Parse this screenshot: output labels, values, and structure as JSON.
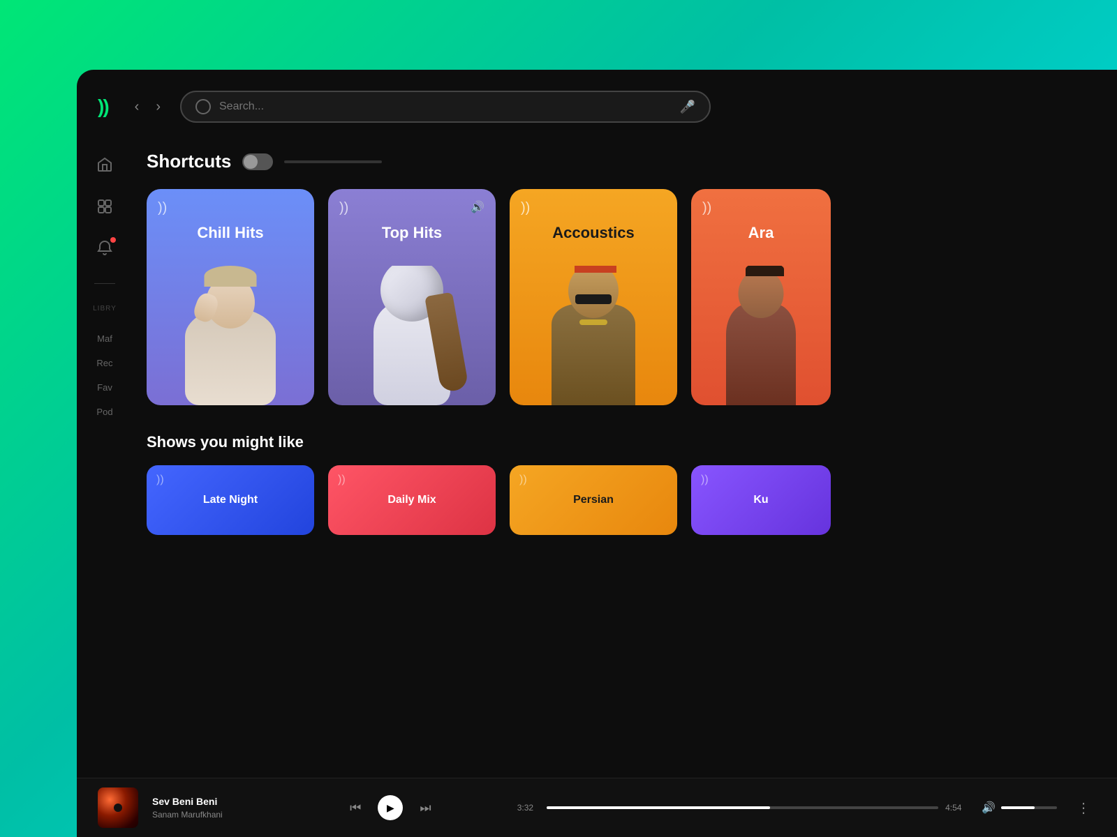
{
  "app": {
    "logo": "))",
    "background_gradient_start": "#00e676",
    "background_gradient_end": "#00e5ff"
  },
  "header": {
    "back_label": "‹",
    "forward_label": "›",
    "search_placeholder": "Search..."
  },
  "sidebar": {
    "icons": [
      {
        "name": "home-icon",
        "symbol": "⌂"
      },
      {
        "name": "browse-icon",
        "symbol": "⬡"
      },
      {
        "name": "notifications-icon",
        "symbol": "⊙",
        "has_dot": true
      }
    ],
    "library_label": "LIBRY",
    "items": [
      {
        "name": "made-for-you",
        "label": "Maf"
      },
      {
        "name": "recent",
        "label": "Rec"
      },
      {
        "name": "favorites",
        "label": "Fav"
      },
      {
        "name": "podcasts",
        "label": "Pod"
      }
    ]
  },
  "shortcuts": {
    "section_title": "Shortcuts",
    "cards": [
      {
        "id": "chill-hits",
        "title": "Chill Hits",
        "bg_start": "#6b8ff8",
        "bg_end": "#7b6fd4",
        "is_playing": false,
        "icon": "))"
      },
      {
        "id": "top-hits",
        "title": "Top Hits",
        "bg_start": "#8b7fd4",
        "bg_end": "#6b5fa8",
        "is_playing": true,
        "icon": "))"
      },
      {
        "id": "acoustics",
        "title": "Accoustics",
        "bg_start": "#f5a623",
        "bg_end": "#e8870d",
        "is_playing": false,
        "icon": "))"
      },
      {
        "id": "arabic",
        "title": "Ara",
        "bg_start": "#f07040",
        "bg_end": "#e05030",
        "is_playing": false,
        "icon": "))"
      }
    ]
  },
  "shows": {
    "section_title": "Shows you might like",
    "cards": [
      {
        "id": "late-night",
        "title": "Late Night",
        "icon": "))"
      },
      {
        "id": "daily-mix",
        "title": "Daily Mix",
        "icon": "))"
      },
      {
        "id": "persian",
        "title": "Persian",
        "icon": "))"
      },
      {
        "id": "ku",
        "title": "Ku",
        "icon": "))"
      }
    ]
  },
  "player": {
    "album_art_alt": "Sev Beni Beni album art",
    "track_title": "Sev Beni Beni",
    "track_artist": "Sanam Marufkhani",
    "current_time": "3:32",
    "total_time": "4:54",
    "progress_percent": 57,
    "volume_percent": 60,
    "prev_icon": "⏮",
    "play_icon": "▶",
    "next_icon": "⏭",
    "volume_icon": "🔊",
    "more_icon": "⋮"
  }
}
